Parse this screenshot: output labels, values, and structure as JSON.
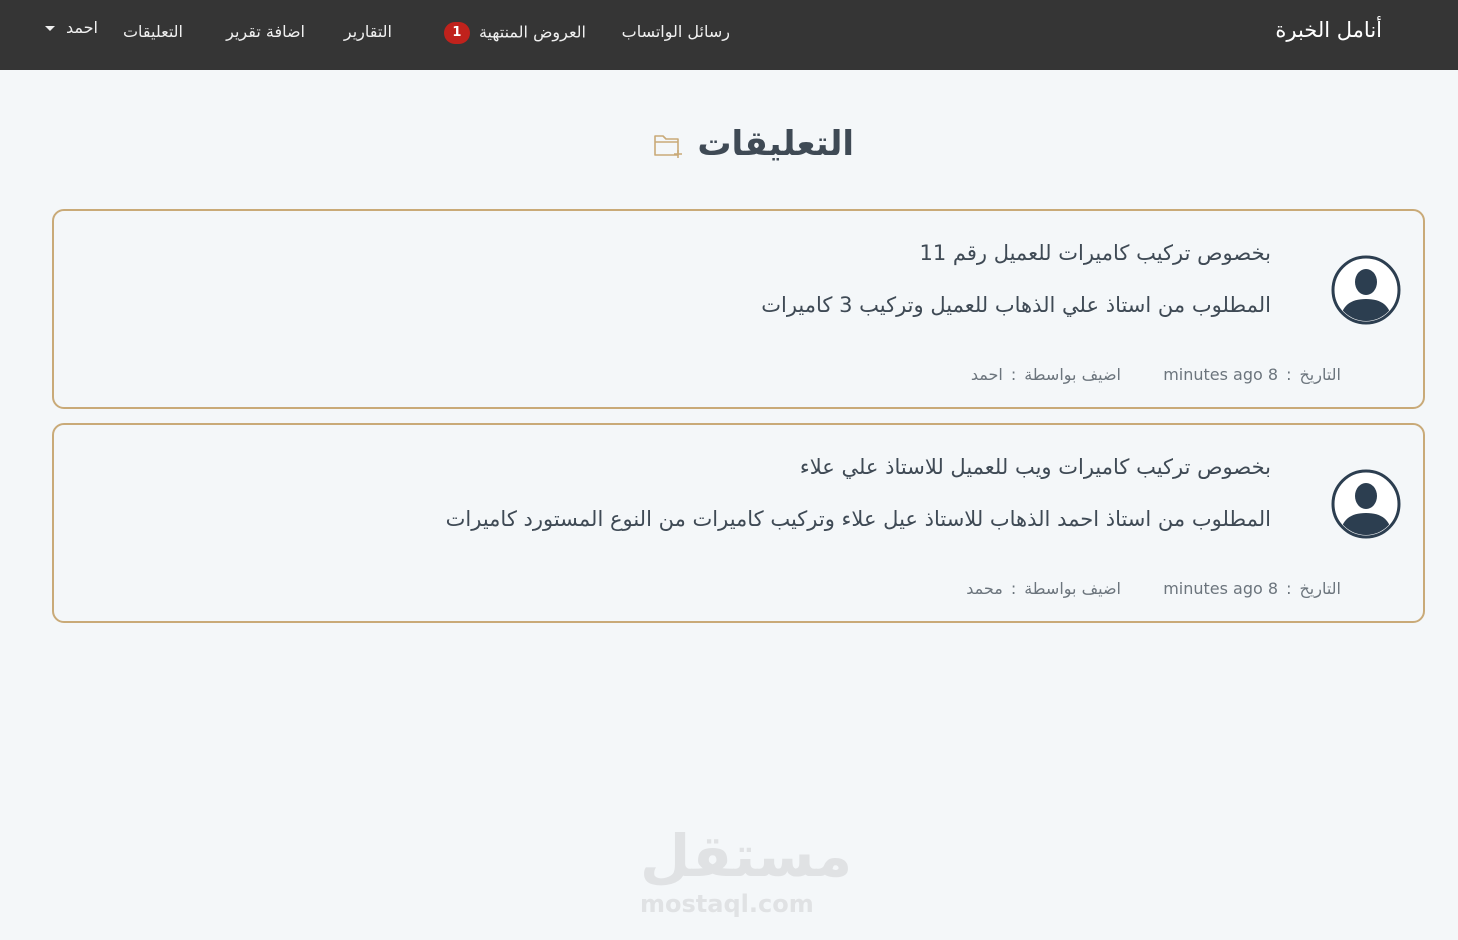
{
  "navbar": {
    "brand": "أنامل الخبرة",
    "links": {
      "whatsapp": "رسائل الواتساب",
      "expired_offers": "العروض المنتهية",
      "expired_badge": "1",
      "reports": "التقارير",
      "add_report": "اضافة تقرير",
      "comments": "التعليقات",
      "user": "احمد"
    }
  },
  "page": {
    "title": "التعليقات"
  },
  "comments": [
    {
      "title": "بخصوص تركيب كاميرات للعميل رقم 11",
      "body": "المطلوب من استاذ علي الذهاب للعميل وتركيب 3 كاميرات",
      "date_label": "التاريخ",
      "date_value": "8 minutes ago",
      "author_label": "اضيف بواسطة",
      "author_value": "احمد"
    },
    {
      "title": "بخصوص تركيب كاميرات ويب للعميل للاستاذ علي علاء",
      "body": "المطلوب من استاذ احمد الذهاب للاستاذ عيل علاء وتركيب كاميرات من النوع المستورد كاميرات",
      "date_label": "التاريخ",
      "date_value": "8 minutes ago",
      "author_label": "اضيف بواسطة",
      "author_value": "محمد"
    }
  ],
  "meta_separator": ":",
  "watermark": {
    "arabic": "مستقل",
    "latin": "mostaql.com"
  },
  "colors": {
    "navbar_bg": "#353535",
    "card_border": "#c9aa78",
    "badge_bg": "#c0221c",
    "avatar": "#2c3e50"
  },
  "icons": {
    "header": "folder-plus-icon",
    "avatar": "user-avatar-icon",
    "user_menu": "caret-down-icon"
  }
}
